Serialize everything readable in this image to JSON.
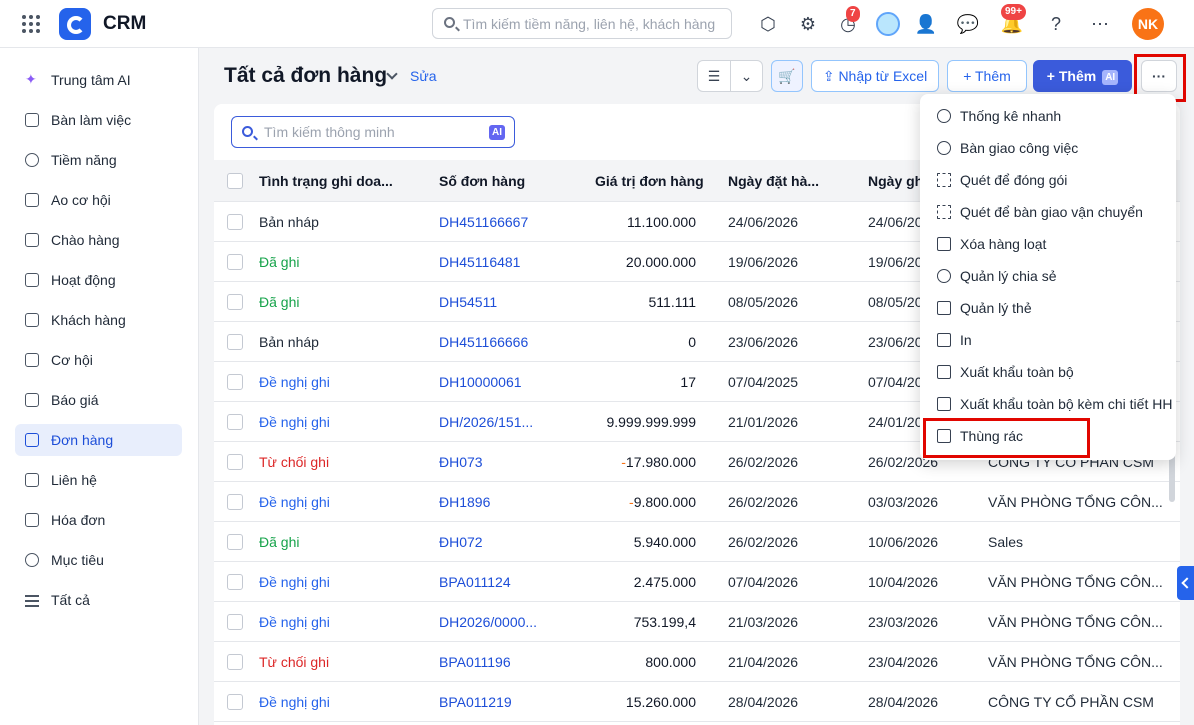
{
  "header": {
    "app_name": "CRM",
    "search_placeholder": "Tìm kiếm tiềm năng, liên hệ, khách hàng",
    "reminder_count": "7",
    "notification_count": "99+",
    "avatar_initials": "NK"
  },
  "sidebar": {
    "items": [
      {
        "label": "Trung tâm AI",
        "icon": "ai-sparkle-icon"
      },
      {
        "label": "Bàn làm việc",
        "icon": "home-icon"
      },
      {
        "label": "Tiềm năng",
        "icon": "prospect-icon"
      },
      {
        "label": "Ao cơ hội",
        "icon": "pool-icon"
      },
      {
        "label": "Chào hàng",
        "icon": "campaign-icon"
      },
      {
        "label": "Hoạt động",
        "icon": "activity-icon"
      },
      {
        "label": "Khách hàng",
        "icon": "building-icon"
      },
      {
        "label": "Cơ hội",
        "icon": "opportunity-icon"
      },
      {
        "label": "Báo giá",
        "icon": "quote-icon"
      },
      {
        "label": "Đơn hàng",
        "icon": "cart-icon",
        "active": true
      },
      {
        "label": "Liên hệ",
        "icon": "contact-icon"
      },
      {
        "label": "Hóa đơn",
        "icon": "invoice-icon"
      },
      {
        "label": "Mục tiêu",
        "icon": "target-icon"
      },
      {
        "label": "Tất cả",
        "icon": "menu-icon"
      }
    ]
  },
  "page": {
    "title": "Tất cả đơn hàng",
    "edit_label": "Sửa"
  },
  "toolbar": {
    "import_label": "Nhập từ Excel",
    "add_label": "Thêm",
    "add_ai_label": "Thêm",
    "ai_tag": "AI",
    "more_label": "···"
  },
  "smart_search": {
    "placeholder": "Tìm kiếm thông minh",
    "ai_tag": "AI"
  },
  "table": {
    "columns": [
      "Tình trạng ghi doa...",
      "Số đơn hàng",
      "Giá trị đơn hàng",
      "Ngày đặt hà...",
      "Ngày ghi"
    ],
    "rows": [
      {
        "status": "Bản nháp",
        "status_type": "draft",
        "code": "DH451166667",
        "value": "11.100.000",
        "order_date": "24/06/2026",
        "record_date": "24/06/2026",
        "customer": ""
      },
      {
        "status": "Đã ghi",
        "status_type": "done",
        "code": "DH45116481",
        "value": "20.000.000",
        "order_date": "19/06/2026",
        "record_date": "19/06/2026",
        "customer": ""
      },
      {
        "status": "Đã ghi",
        "status_type": "done",
        "code": "DH54511",
        "value": "511.111",
        "order_date": "08/05/2026",
        "record_date": "08/05/2026",
        "customer": ""
      },
      {
        "status": "Bản nháp",
        "status_type": "draft",
        "code": "DH451166666",
        "value": "0",
        "order_date": "23/06/2026",
        "record_date": "23/06/2026",
        "customer": ""
      },
      {
        "status": "Đề nghị ghi",
        "status_type": "prop",
        "code": "DH10000061",
        "value": "17",
        "order_date": "07/04/2025",
        "record_date": "07/04/2025",
        "customer": ""
      },
      {
        "status": "Đề nghị ghi",
        "status_type": "prop",
        "code": "DH/2026/151...",
        "value": "9.999.999.999",
        "order_date": "21/01/2026",
        "record_date": "24/01/2026",
        "customer": ""
      },
      {
        "status": "Từ chối ghi",
        "status_type": "rej",
        "code": "ĐH073",
        "value": "-17.980.000",
        "order_date": "26/02/2026",
        "record_date": "26/02/2026",
        "customer": "CÔNG TY CỔ PHẦN CSM"
      },
      {
        "status": "Đề nghị ghi",
        "status_type": "prop",
        "code": "ĐH1896",
        "value": "-9.800.000",
        "order_date": "26/02/2026",
        "record_date": "03/03/2026",
        "customer": "VĂN PHÒNG TỔNG CÔN..."
      },
      {
        "status": "Đã ghi",
        "status_type": "done",
        "code": "ĐH072",
        "value": "5.940.000",
        "order_date": "26/02/2026",
        "record_date": "10/06/2026",
        "customer": "Sales"
      },
      {
        "status": "Đề nghị ghi",
        "status_type": "prop",
        "code": "BPA011124",
        "value": "2.475.000",
        "order_date": "07/04/2026",
        "record_date": "10/04/2026",
        "customer": "VĂN PHÒNG TỔNG CÔN..."
      },
      {
        "status": "Đề nghị ghi",
        "status_type": "prop",
        "code": "DH2026/0000...",
        "value": "753.199,4",
        "order_date": "21/03/2026",
        "record_date": "23/03/2026",
        "customer": "VĂN PHÒNG TỔNG CÔN..."
      },
      {
        "status": "Từ chối ghi",
        "status_type": "rej",
        "code": "BPA011196",
        "value": "800.000",
        "order_date": "21/04/2026",
        "record_date": "23/04/2026",
        "customer": "VĂN PHÒNG TỔNG CÔN..."
      },
      {
        "status": "Đề nghị ghi",
        "status_type": "prop",
        "code": "BPA011219",
        "value": "15.260.000",
        "order_date": "28/04/2026",
        "record_date": "28/04/2026",
        "customer": "CÔNG TY CỔ PHẦN CSM"
      }
    ]
  },
  "more_menu": {
    "items": [
      {
        "label": "Thống kê nhanh",
        "icon": "clock-chart-icon"
      },
      {
        "label": "Bàn giao công việc",
        "icon": "handover-icon"
      },
      {
        "label": "Quét để đóng gói",
        "icon": "scan-icon"
      },
      {
        "label": "Quét để bàn giao vận chuyển",
        "icon": "scan-icon"
      },
      {
        "label": "Xóa hàng loạt",
        "icon": "trash-icon"
      },
      {
        "label": "Quản lý chia sẻ",
        "icon": "share-icon"
      },
      {
        "label": "Quản lý thẻ",
        "icon": "tag-icon"
      },
      {
        "label": "In",
        "icon": "printer-icon"
      },
      {
        "label": "Xuất khẩu toàn bộ",
        "icon": "export-icon"
      },
      {
        "label": "Xuất khẩu toàn bộ kèm chi tiết HH",
        "icon": "export-icon"
      },
      {
        "label": "Thùng rác",
        "icon": "recycle-bin-icon"
      }
    ]
  },
  "colors": {
    "accent": "#2563eb",
    "primary_button": "#3b5bdb",
    "highlight_box": "#e10600",
    "avatar": "#f97316"
  }
}
